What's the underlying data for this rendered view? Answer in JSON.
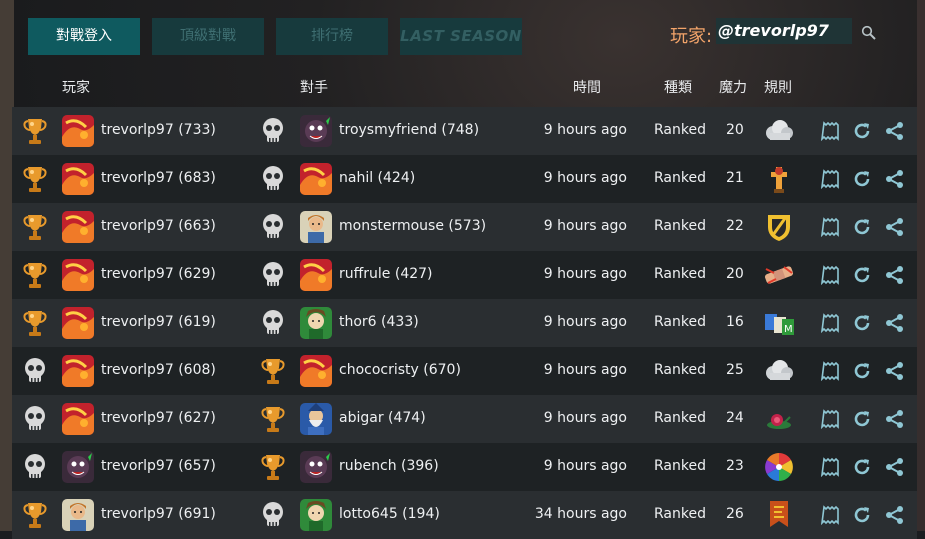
{
  "tabs": [
    "對戰登入",
    "頂級對戰",
    "排行榜",
    "LAST SEASON"
  ],
  "player": {
    "label": "玩家:",
    "name": "@trevorlp97"
  },
  "headers": {
    "player": "玩家",
    "opponent": "對手",
    "time": "時間",
    "type": "種類",
    "mana": "魔力",
    "rules": "規則"
  },
  "rows": [
    {
      "result": "trophy",
      "player": "trevorlp97 (733)",
      "player_avatar": "red-dragon",
      "opp_result": "skull",
      "opponent": "troysmyfriend (748)",
      "opp_avatar": "dark-creature",
      "time": "9 hours ago",
      "type": "Ranked",
      "mana": "20",
      "rule": "cloud-rule-icon"
    },
    {
      "result": "trophy",
      "player": "trevorlp97 (683)",
      "player_avatar": "red-dragon",
      "opp_result": "skull",
      "opponent": "nahil (424)",
      "opp_avatar": "red-dragon",
      "time": "9 hours ago",
      "type": "Ranked",
      "mana": "21",
      "rule": "shrine-rule-icon"
    },
    {
      "result": "trophy",
      "player": "trevorlp97 (663)",
      "player_avatar": "red-dragon",
      "opp_result": "skull",
      "opponent": "monstermouse (573)",
      "opp_avatar": "knight",
      "time": "9 hours ago",
      "type": "Ranked",
      "mana": "22",
      "rule": "shield-rule-icon"
    },
    {
      "result": "trophy",
      "player": "trevorlp97 (629)",
      "player_avatar": "red-dragon",
      "opp_result": "skull",
      "opponent": "ruffrule (427)",
      "opp_avatar": "red-dragon",
      "time": "9 hours ago",
      "type": "Ranked",
      "mana": "20",
      "rule": "bandage-rule-icon"
    },
    {
      "result": "trophy",
      "player": "trevorlp97 (619)",
      "player_avatar": "red-dragon",
      "opp_result": "skull",
      "opponent": "thor6 (433)",
      "opp_avatar": "green-elf",
      "time": "9 hours ago",
      "type": "Ranked",
      "mana": "16",
      "rule": "cards-rule-icon"
    },
    {
      "result": "skull",
      "player": "trevorlp97 (608)",
      "player_avatar": "red-dragon",
      "opp_result": "trophy",
      "opponent": "chococristy (670)",
      "opp_avatar": "red-dragon",
      "time": "9 hours ago",
      "type": "Ranked",
      "mana": "25",
      "rule": "cloud-rule-icon"
    },
    {
      "result": "skull",
      "player": "trevorlp97 (627)",
      "player_avatar": "red-dragon",
      "opp_result": "trophy",
      "opponent": "abigar (474)",
      "opp_avatar": "blue-wizard",
      "time": "9 hours ago",
      "type": "Ranked",
      "mana": "24",
      "rule": "snail-rule-icon"
    },
    {
      "result": "skull",
      "player": "trevorlp97 (657)",
      "player_avatar": "dark-creature",
      "opp_result": "trophy",
      "opponent": "rubench (396)",
      "opp_avatar": "dark-creature",
      "time": "9 hours ago",
      "type": "Ranked",
      "mana": "23",
      "rule": "rainbow-rule-icon"
    },
    {
      "result": "trophy",
      "player": "trevorlp97 (691)",
      "player_avatar": "knight",
      "opp_result": "skull",
      "opponent": "lotto645 (194)",
      "opp_avatar": "green-elf",
      "time": "34 hours ago",
      "type": "Ranked",
      "mana": "26",
      "rule": "banner-rule-icon"
    }
  ],
  "colors": {
    "accent": "#0f5a5f",
    "action_icon": "#8fc7d4",
    "trophy": "#e89a2c",
    "skull": "#d9d9d9",
    "player_label": "#f3a46a"
  }
}
